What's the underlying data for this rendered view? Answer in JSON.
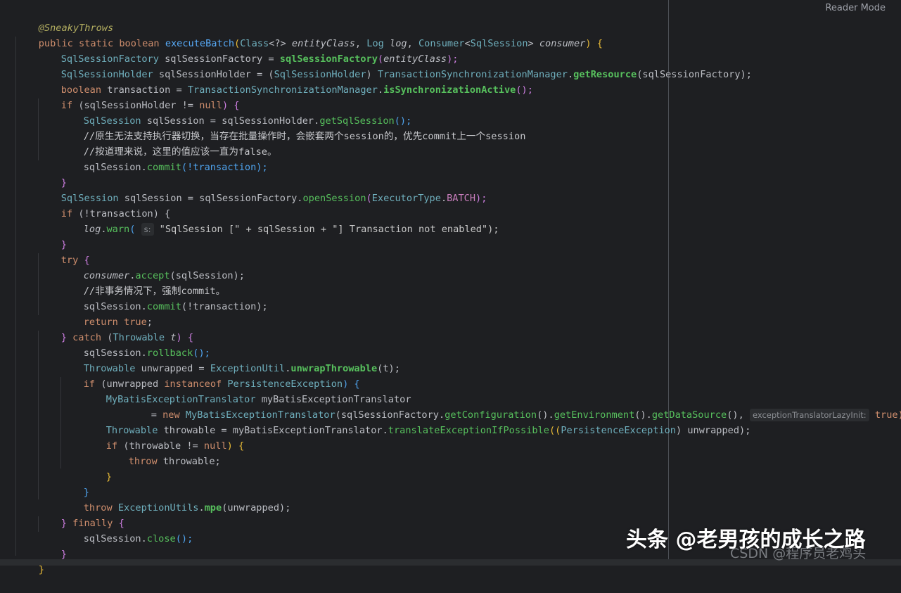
{
  "toolbar": {
    "reader_mode": "Reader Mode"
  },
  "code": {
    "l1": "@SneakyThrows",
    "l2": [
      "public static boolean ",
      "executeBatch",
      "(",
      "Class",
      "<?> ",
      "entityClass",
      ", ",
      "Log ",
      "log",
      ", ",
      "Consumer",
      "<",
      "SqlSession",
      "> ",
      "consumer",
      ") {"
    ],
    "l3": [
      "SqlSessionFactory ",
      "sqlSessionFactory = ",
      "sqlSessionFactory",
      "(",
      "entityClass",
      ");"
    ],
    "l4": [
      "SqlSessionHolder ",
      "sqlSessionHolder = (",
      "SqlSessionHolder",
      ") ",
      "TransactionSynchronizationManager",
      ".",
      "getResource",
      "(sqlSessionFactory);"
    ],
    "l5": [
      "boolean ",
      "transaction = ",
      "TransactionSynchronizationManager",
      ".",
      "isSynchronizationActive",
      "();"
    ],
    "l6": [
      "if ",
      "(sqlSessionHolder != ",
      "null",
      ") {"
    ],
    "l7": [
      "SqlSession ",
      "sqlSession = sqlSessionHolder.",
      "getSqlSession",
      "();"
    ],
    "l8": "//原生无法支持执行器切换，当存在批量操作时，会嵌套两个session的，优先commit上一个session",
    "l9": "//按道理来说，这里的值应该一直为false。",
    "l10": [
      "sqlSession.",
      "commit",
      "(!transaction);"
    ],
    "l11": "}",
    "l12": [
      "SqlSession ",
      "sqlSession = sqlSessionFactory.",
      "openSession",
      "(",
      "ExecutorType",
      ".",
      "BATCH",
      ");"
    ],
    "l13": [
      "if ",
      "(!transaction) {"
    ],
    "l14": [
      "log",
      ".",
      "warn",
      "( ",
      "s:",
      " \"SqlSession [\" + sqlSession + \"] Transaction not enabled\");"
    ],
    "l15": "}",
    "l16": [
      "try ",
      "{"
    ],
    "l17": [
      "consumer",
      ".",
      "accept",
      "(sqlSession);"
    ],
    "l18": "//非事务情况下，强制commit。",
    "l19": [
      "sqlSession.",
      "commit",
      "(!transaction);"
    ],
    "l20": [
      "return ",
      "true",
      ";"
    ],
    "l21": [
      "} ",
      "catch ",
      "(",
      "Throwable ",
      "t",
      ") {"
    ],
    "l22": [
      "sqlSession.",
      "rollback",
      "();"
    ],
    "l23": [
      "Throwable ",
      "unwrapped = ",
      "ExceptionUtil",
      ".",
      "unwrapThrowable",
      "(t);"
    ],
    "l24": [
      "if ",
      "(unwrapped ",
      "instanceof ",
      "PersistenceException",
      ") {"
    ],
    "l25": [
      "MyBatisExceptionTranslator ",
      "myBatisExceptionTranslator"
    ],
    "l26": [
      "= ",
      "new ",
      "MyBatisExceptionTranslator",
      "(sqlSessionFactory.",
      "getConfiguration",
      "().",
      "getEnvironment",
      "().",
      "getDataSource",
      "(), ",
      "exceptionTranslatorLazyInit:",
      " true);"
    ],
    "l27": [
      "Throwable ",
      "throwable = myBatisExceptionTranslator.",
      "translateExceptionIfPossible",
      "((",
      "PersistenceException",
      ") unwrapped);"
    ],
    "l28": [
      "if ",
      "(throwable != ",
      "null",
      ") {"
    ],
    "l29": [
      "throw ",
      "throwable;"
    ],
    "l30": "}",
    "l31": "}",
    "l32": [
      "throw ",
      "ExceptionUtils",
      ".",
      "mpe",
      "(unwrapped);"
    ],
    "l33": [
      "} ",
      "finally ",
      "{"
    ],
    "l34": [
      "sqlSession.",
      "close",
      "();"
    ],
    "l35": "}",
    "l36": "}"
  },
  "watermark": {
    "primary": "头条 @老男孩的成长之路",
    "secondary": "CSDN @程序员老鸡头"
  },
  "colors": {
    "background": "#1e1f22",
    "keyword": "#cf8e6d",
    "type": "#6fafbd",
    "method_call": "#57c05d",
    "annotation": "#b3ae60",
    "comment": "#7a7e85"
  }
}
